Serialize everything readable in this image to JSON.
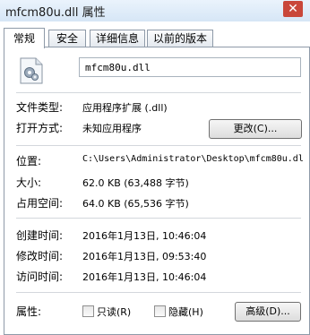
{
  "window": {
    "title": "mfcm80u.dll 属性",
    "close_glyph": "✕"
  },
  "tabs": [
    {
      "label": "常规"
    },
    {
      "label": "安全"
    },
    {
      "label": "详细信息"
    },
    {
      "label": "以前的版本"
    }
  ],
  "file_name": "mfcm80u.dll",
  "general": {
    "type_label": "文件类型:",
    "type_value": "应用程序扩展 (.dll)",
    "open_label": "打开方式:",
    "open_value": "未知应用程序",
    "change_button": "更改(C)...",
    "location_label": "位置:",
    "location_value": "C:\\Users\\Administrator\\Desktop\\mfcm80u.dl",
    "size_label": "大小:",
    "size_value": "62.0 KB (63,488 字节)",
    "disk_label": "占用空间:",
    "disk_value": "64.0 KB (65,536 字节)",
    "created_label": "创建时间:",
    "created_value": "2016年1月13日, 10:46:04",
    "modified_label": "修改时间:",
    "modified_value": "2016年1月13日, 09:53:40",
    "accessed_label": "访问时间:",
    "accessed_value": "2016年1月13日, 10:46:04",
    "attr_label": "属性:",
    "readonly_label": "只读(R)",
    "hidden_label": "隐藏(H)",
    "advanced_button": "高级(D)..."
  },
  "icons": {
    "file": "dll-file-gear-icon",
    "close": "close-icon"
  }
}
